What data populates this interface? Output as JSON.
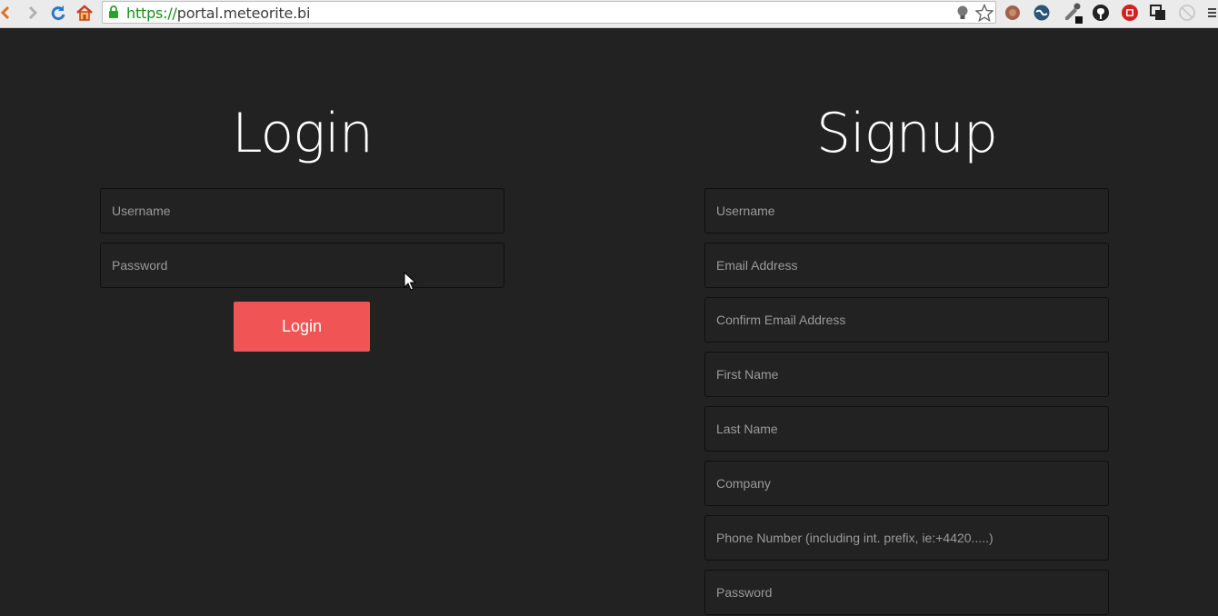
{
  "browser": {
    "url_scheme": "https://",
    "url_host": "portal.meteorite.bi",
    "icons": [
      "back-icon",
      "forward-icon",
      "reload-icon",
      "home-icon",
      "lock-icon",
      "bulb-icon",
      "star-icon",
      "coconut-extension-icon",
      "globe-extension-icon",
      "eyedropper-extension-icon",
      "github-icon",
      "stop-extension-icon",
      "windows-extension-icon",
      "blocked-extension-icon",
      "menu-icon"
    ]
  },
  "login": {
    "title": "Login",
    "username_placeholder": "Username",
    "password_placeholder": "Password",
    "button_label": "Login"
  },
  "signup": {
    "title": "Signup",
    "fields": [
      "Username",
      "Email Address",
      "Confirm Email Address",
      "First Name",
      "Last Name",
      "Company",
      "Phone Number (including int. prefix, ie:+4420.....)",
      "Password"
    ]
  },
  "colors": {
    "background": "#222222",
    "button": "#f05454",
    "placeholder": "#9a9a9a"
  }
}
